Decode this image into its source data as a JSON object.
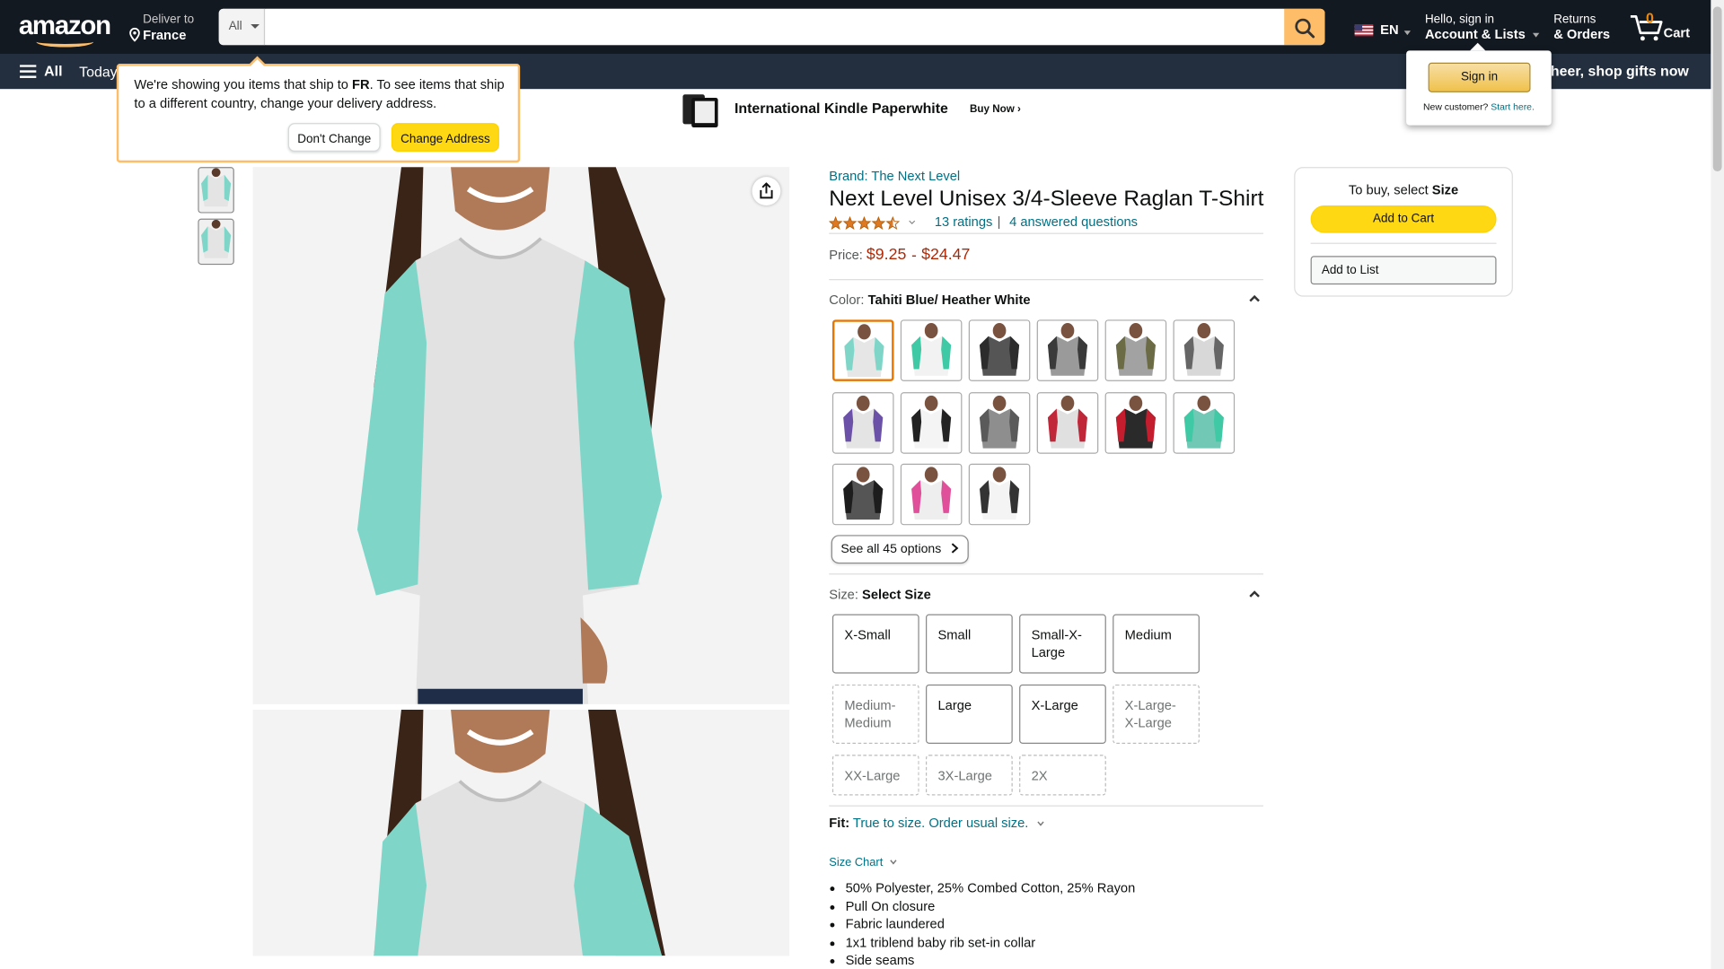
{
  "header": {
    "logo": "amazon",
    "deliver_label": "Deliver to",
    "deliver_country": "France",
    "search_category": "All",
    "search_placeholder": "",
    "language": "EN",
    "account_greeting": "Hello, sign in",
    "account_label": "Account & Lists",
    "returns_label": "Returns",
    "orders_label": "& Orders",
    "cart_count": "0",
    "cart_label": "Cart"
  },
  "nav": {
    "all_label": "All",
    "today_label": "Today's",
    "promo": "e cheer, shop gifts now"
  },
  "banner": {
    "title": "International Kindle Paperwhite",
    "cta": "Buy Now ›"
  },
  "delivery_popover": {
    "text_before": "We're showing you items that ship to ",
    "country_code": "FR",
    "text_after": ". To see items that ship to a different country, change your delivery address.",
    "dont_change": "Don't Change",
    "change_address": "Change Address"
  },
  "signin_popover": {
    "button": "Sign in",
    "new_customer": "New customer?",
    "start_here": "Start here."
  },
  "product": {
    "brand": "Brand: The Next Level",
    "title": "Next Level Unisex 3/4-Sleeve Raglan T-Shirt",
    "rating": 4.5,
    "ratings_count": "13 ratings",
    "separator": "|",
    "questions": "4 answered questions",
    "price_label": "Price:",
    "price_low": "$9.25",
    "price_dash": "-",
    "price_high": "$24.47",
    "color_label": "Color:",
    "color_value": "Tahiti Blue/ Heather White",
    "see_all": "See all 45 options",
    "size_label": "Size:",
    "size_value": "Select Size",
    "sizes": [
      {
        "label": "X-Small",
        "available": true
      },
      {
        "label": "Small",
        "available": true
      },
      {
        "label": "Small-X-Large",
        "available": true
      },
      {
        "label": "Medium",
        "available": true
      },
      {
        "label": "Medium-Medium",
        "available": false
      },
      {
        "label": "Large",
        "available": true
      },
      {
        "label": "X-Large",
        "available": true
      },
      {
        "label": "X-Large-X-Large",
        "available": false
      },
      {
        "label": "XX-Large",
        "available": false
      },
      {
        "label": "3X-Large",
        "available": false
      },
      {
        "label": "2X",
        "available": false
      }
    ],
    "fit_label": "Fit:",
    "fit_value": "True to size. Order usual size.",
    "size_chart": "Size Chart",
    "bullets": [
      "50% Polyester, 25% Combed Cotton, 25% Rayon",
      "Pull On closure",
      "Fabric laundered",
      "1x1 triblend baby rib set-in collar",
      "Side seams"
    ]
  },
  "swatches": [
    {
      "sleeve": "#7fd6c8",
      "body": "#e6e6e6",
      "selected": true
    },
    {
      "sleeve": "#3fc9a4",
      "body": "#f2f2f2",
      "selected": false
    },
    {
      "sleeve": "#2c2c2c",
      "body": "#555555",
      "selected": false
    },
    {
      "sleeve": "#3a3a3a",
      "body": "#9a9a9a",
      "selected": false
    },
    {
      "sleeve": "#6b6b45",
      "body": "#a2a2a2",
      "selected": false
    },
    {
      "sleeve": "#666666",
      "body": "#d8d8d8",
      "selected": false
    },
    {
      "sleeve": "#6b52a8",
      "body": "#e4e4e4",
      "selected": false
    },
    {
      "sleeve": "#222222",
      "body": "#f4f4f4",
      "selected": false
    },
    {
      "sleeve": "#5a5a5a",
      "body": "#8e8e8e",
      "selected": false
    },
    {
      "sleeve": "#c0283a",
      "body": "#e0e0e0",
      "selected": false
    },
    {
      "sleeve": "#c41e2e",
      "body": "#2a2a2a",
      "selected": false
    },
    {
      "sleeve": "#3fc9a4",
      "body": "#70c8b5",
      "selected": false
    },
    {
      "sleeve": "#1d1d1d",
      "body": "#555555",
      "selected": false
    },
    {
      "sleeve": "#e0509a",
      "body": "#eeeeee",
      "selected": false
    },
    {
      "sleeve": "#333333",
      "body": "#f4f4f4",
      "selected": false
    }
  ],
  "buy_box": {
    "to_buy_prefix": "To buy, select ",
    "to_buy_field": "Size",
    "add_to_cart": "Add to Cart",
    "add_to_list": "Add to List"
  },
  "colors": {
    "header_bg": "#131921",
    "nav_bg": "#232f3e",
    "search_btn": "#febd69",
    "price": "#b12704",
    "link": "#007185",
    "star": "#de7921",
    "cart_yellow": "#ffd814",
    "selected_border": "#e77600"
  }
}
